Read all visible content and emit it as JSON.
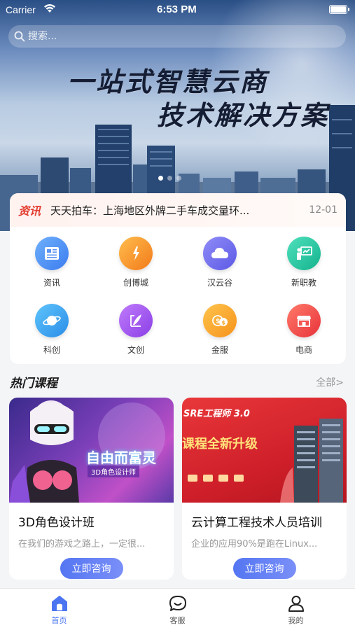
{
  "status_bar": {
    "carrier": "Carrier",
    "time": "6:53 PM"
  },
  "search": {
    "placeholder": "搜索..."
  },
  "banner": {
    "line1": "一站式智慧云商",
    "line2": "技术解决方案",
    "slide_count": 3,
    "active_slide": 1
  },
  "news": {
    "tag": "资讯",
    "text": "天天拍车：上海地区外牌二手车成交量环...",
    "date": "12-01"
  },
  "quick_menu": [
    {
      "label": "资讯",
      "icon": "newspaper-icon",
      "color": "#4d8ef5"
    },
    {
      "label": "创博城",
      "icon": "spark-icon",
      "color": "#f59a2a"
    },
    {
      "label": "汉云谷",
      "icon": "cloud-icon",
      "color": "#6d6af0"
    },
    {
      "label": "新职教",
      "icon": "teacher-board-icon",
      "color": "#26c9a4"
    },
    {
      "label": "科创",
      "icon": "planet-icon",
      "color": "#3aa9f0"
    },
    {
      "label": "文创",
      "icon": "quill-icon",
      "color": "#a35af0"
    },
    {
      "label": "金服",
      "icon": "coins-icon",
      "color": "#f5a623"
    },
    {
      "label": "电商",
      "icon": "shop-icon",
      "color": "#f04848"
    }
  ],
  "hot_courses": {
    "title": "热门课程",
    "more": "全部>",
    "items": [
      {
        "title": "3D角色设计班",
        "desc": "在我们的游戏之路上，一定很...",
        "button": "立即咨询",
        "thumb_text": {
          "main": "自由而富灵",
          "sub": "3D角色设计师"
        }
      },
      {
        "title": "云计算工程技术人员培训",
        "desc": "企业的应用90%是跑在Linux...",
        "button": "立即咨询",
        "thumb_text": {
          "main": "SRE工程师 3.0",
          "sub": "课程全新升级"
        }
      }
    ]
  },
  "tabbar": [
    {
      "label": "首页",
      "icon": "home-icon",
      "active": true
    },
    {
      "label": "客服",
      "icon": "chat-bubble-icon",
      "active": false
    },
    {
      "label": "我的",
      "icon": "user-icon",
      "active": false
    }
  ]
}
